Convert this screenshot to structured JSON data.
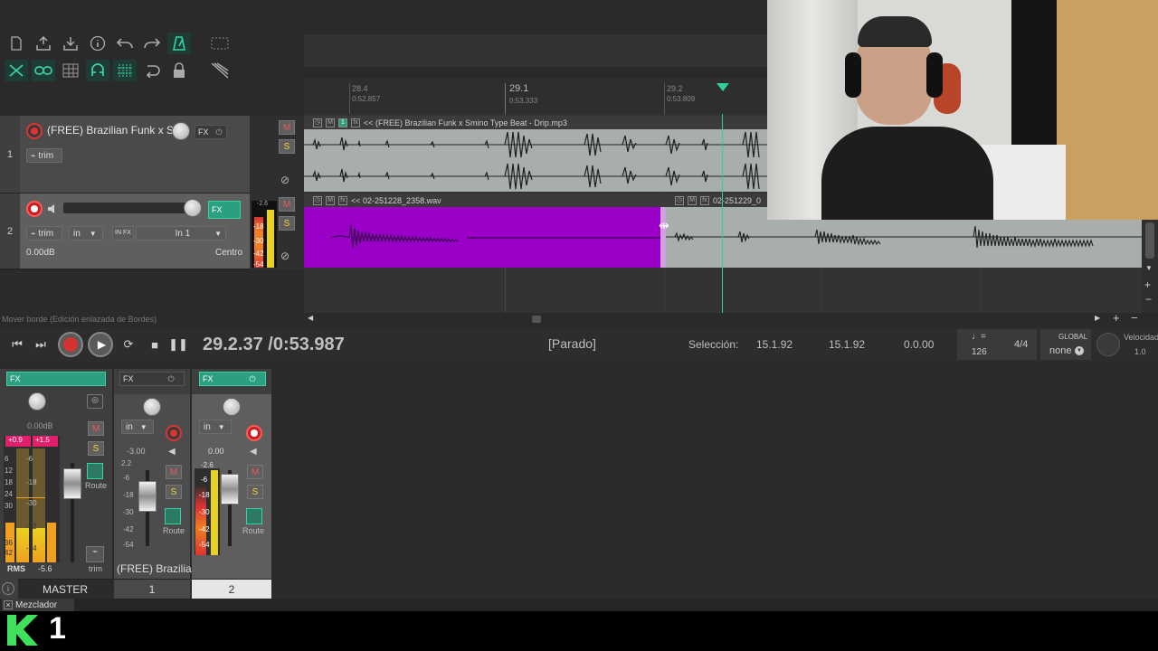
{
  "toolbar": {
    "row1": [
      "new-project-icon",
      "save-icon",
      "open-icon",
      "info-icon",
      "undo-icon",
      "redo-icon",
      "metronome-icon",
      "marquee-icon"
    ],
    "row2": [
      "ripple-icon",
      "link-icon",
      "grid-icon",
      "snap-icon",
      "grid-lines-icon",
      "loop-icon",
      "lock-icon",
      "envelope-icon"
    ]
  },
  "ruler": {
    "marks": [
      {
        "bar": "28.4",
        "time": "0:52.857"
      },
      {
        "bar": "29.1",
        "time": "0:53.333"
      },
      {
        "bar": "29.2",
        "time": "0:53.809"
      }
    ]
  },
  "tracks": [
    {
      "number": "1",
      "name": "(FREE) Brazilian Funk x S",
      "fx_label": "FX",
      "trim_label": "trim",
      "mute": "M",
      "solo": "S"
    },
    {
      "number": "2",
      "name": "",
      "fx_label": "FX",
      "trim_label": "trim",
      "input_mode": "in",
      "input_fx": "IN FX",
      "input_source": "In 1",
      "volume": "0.00dB",
      "pan": "Centro",
      "mute": "M",
      "solo": "S",
      "meter_peak": "-2.6",
      "meter_scale": [
        "-18",
        "-30",
        "-42",
        "-54"
      ]
    }
  ],
  "items": [
    {
      "name": "<< (FREE) Brazilian Funk x Smino Type Beat - Drip.mp3",
      "take": "1"
    },
    {
      "name": "<< 02-251228_2358.wav"
    },
    {
      "name": "02-251229_0"
    }
  ],
  "status_hint": "Mover borde (Edición enlazada de Bordes)",
  "transport": {
    "position": "29.2.37 /0:53.987",
    "state": "[Parado]",
    "selection_label": "Selección:",
    "sel_start": "15.1.92",
    "sel_end": "15.1.92",
    "sel_length": "0.0.00",
    "tempo_icon": "♩=",
    "tempo": "126",
    "timesig": "4/4",
    "global_label": "GLOBAL",
    "global_value": "none",
    "rate_label": "Velocidad",
    "rate_value": "1.0"
  },
  "mixer": {
    "master": {
      "fx_label": "FX",
      "volume": "0.00dB",
      "peak_left": "+0.9",
      "peak_right": "+1.5",
      "rms_label": "RMS",
      "rms_value": "-5.6",
      "mute": "M",
      "solo": "S",
      "route": "Route",
      "trim": "trim",
      "name": "MASTER",
      "scale": [
        "6",
        "12",
        "18",
        "24",
        "30",
        "36",
        "42",
        "54"
      ],
      "scale_mid": [
        "-6",
        "-18",
        "-30",
        "-42",
        "-54"
      ]
    },
    "strips": [
      {
        "fx_label": "FX",
        "input": "in",
        "volume": "-3.00",
        "peak": "2.2",
        "mute": "M",
        "solo": "S",
        "route": "Route",
        "scale": [
          "-6",
          "-18",
          "-30",
          "-42",
          "-54"
        ],
        "name": "(FREE) Brazilia",
        "number": "1"
      },
      {
        "fx_label": "FX",
        "input": "in",
        "volume": "0.00",
        "peak": "-2.6",
        "mute": "M",
        "solo": "S",
        "route": "Route",
        "scale": [
          "-6",
          "-18",
          "-30",
          "-42",
          "-54"
        ],
        "name": "",
        "number": "2"
      }
    ]
  },
  "docker_tab": "Mezclador",
  "watermark": "1",
  "colors": {
    "accent": "#39d0a8",
    "item_selected": "#9a00c8",
    "record": "#d33333"
  }
}
